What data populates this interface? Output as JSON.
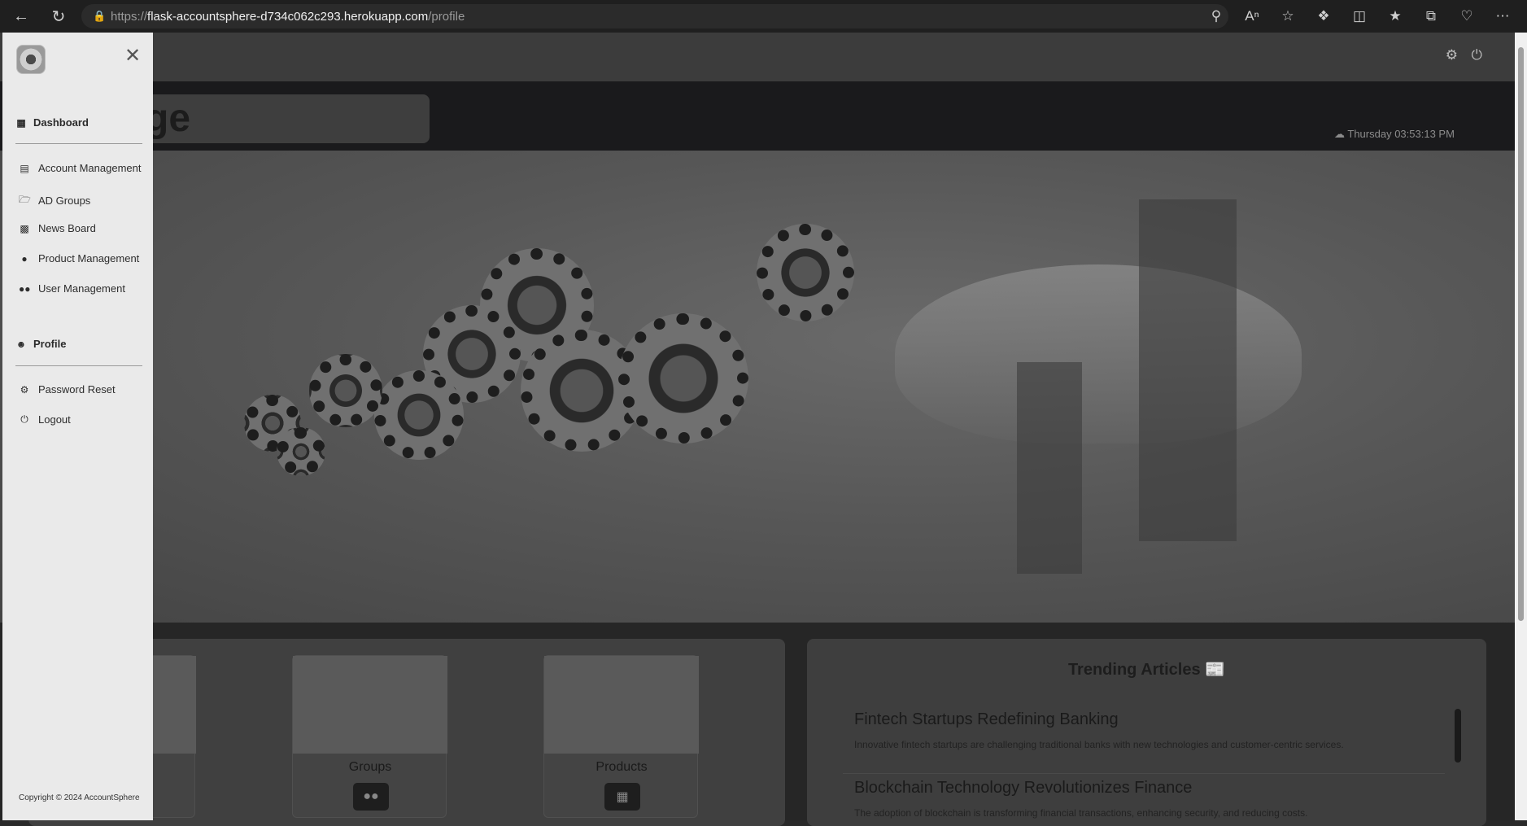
{
  "browser": {
    "url_proto": "https://",
    "url_host": "flask-accountsphere-d734c062c293.herokuapp.com",
    "url_path": "/profile"
  },
  "header": {
    "title": "orge",
    "clock": "Thursday 03:53:13 PM"
  },
  "sidebar": {
    "dashboard_label": "Dashboard",
    "items": [
      {
        "label": "Account Management",
        "icon": "document-icon"
      },
      {
        "label": "AD Groups",
        "icon": "folder-icon"
      },
      {
        "label": "News Board",
        "icon": "newspaper-icon"
      },
      {
        "label": "Product Management",
        "icon": "product-hunt-icon"
      },
      {
        "label": "User Management",
        "icon": "users-icon"
      }
    ],
    "profile_label": "Profile",
    "profile_items": [
      {
        "label": "Password Reset",
        "icon": "gear-icon"
      },
      {
        "label": "Logout",
        "icon": "power-icon"
      }
    ],
    "copyright": "Copyright © 2024 AccountSphere"
  },
  "features": [
    {
      "label": "",
      "icon": "id-card-icon"
    },
    {
      "label": "Groups",
      "icon": "users-icon"
    },
    {
      "label": "Products",
      "icon": "box-icon"
    }
  ],
  "articles": {
    "title": "Trending Articles",
    "items": [
      {
        "title": "Fintech Startups Redefining Banking",
        "desc": "Innovative fintech startups are challenging traditional banks with new technologies and customer-centric services."
      },
      {
        "title": "Blockchain Technology Revolutionizes Finance",
        "desc": "The adoption of blockchain is transforming financial transactions, enhancing security, and reducing costs."
      }
    ]
  }
}
